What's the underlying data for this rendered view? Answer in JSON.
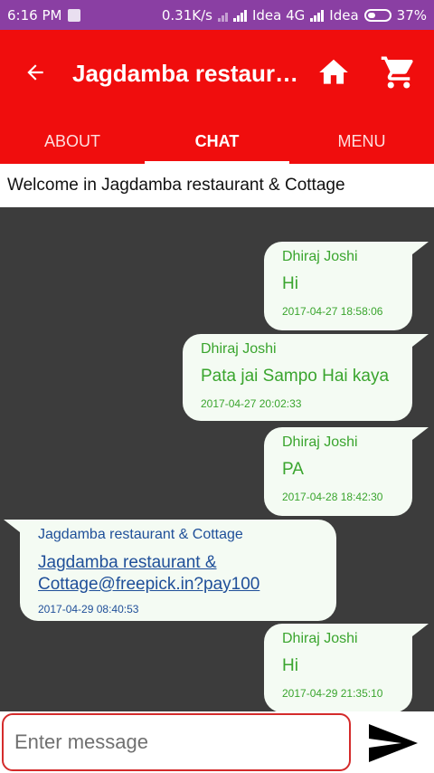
{
  "status_bar": {
    "time": "6:16 PM",
    "speed": "0.31K/s",
    "carrier1": "Idea 4G",
    "carrier2": "Idea",
    "battery": "37%"
  },
  "app_bar": {
    "title": "Jagdamba restaurant & Cottage",
    "back_icon": "arrow-back-icon",
    "home_icon": "home-icon",
    "cart_icon": "cart-icon"
  },
  "tabs": [
    {
      "label": "ABOUT",
      "active": false
    },
    {
      "label": "CHAT",
      "active": true
    },
    {
      "label": "MENU",
      "active": false
    }
  ],
  "welcome": "Welcome in Jagdamba restaurant & Cottage",
  "messages": [
    {
      "sender": "Dhiraj Joshi",
      "text": "Hi",
      "time": "2017-04-27 18:58:06",
      "direction": "outgoing"
    },
    {
      "sender": "Dhiraj Joshi",
      "text": "Pata jai Sampo Hai kaya",
      "time": "2017-04-27 20:02:33",
      "direction": "outgoing"
    },
    {
      "sender": "Dhiraj Joshi",
      "text": "PA",
      "time": "2017-04-28 18:42:30",
      "direction": "outgoing"
    },
    {
      "sender": "Jagdamba restaurant & Cottage",
      "text_line1": "Jagdamba restaurant &",
      "text_line2": "Cottage@freepick.in?pay100",
      "time": "2017-04-29 08:40:53",
      "direction": "incoming"
    },
    {
      "sender": "Dhiraj Joshi",
      "text": "Hi",
      "time": "2017-04-29 21:35:10",
      "direction": "outgoing"
    }
  ],
  "composer": {
    "placeholder": "Enter message",
    "send_icon": "send-icon"
  },
  "colors": {
    "status_bar": "#8a3fa3",
    "app_bar": "#f00d0d",
    "chat_background": "#3c3c3c",
    "bubble": "#f4fbf3",
    "outgoing_text": "#3aa52e",
    "incoming_text": "#1f4f99",
    "input_border": "#d42b2b"
  }
}
